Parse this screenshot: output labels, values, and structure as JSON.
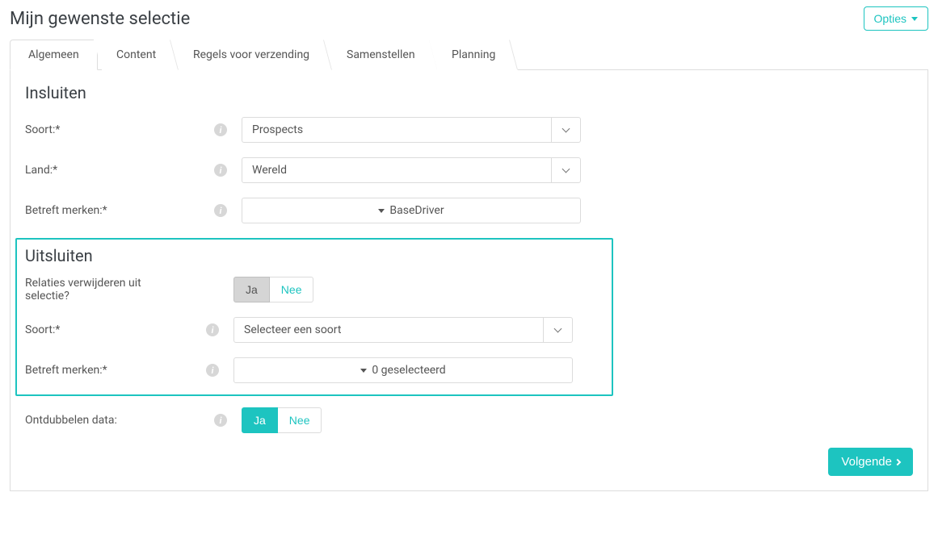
{
  "header": {
    "title": "Mijn gewenste selectie",
    "options_label": "Opties"
  },
  "tabs": [
    {
      "label": "Algemeen",
      "active": true
    },
    {
      "label": "Content",
      "active": false
    },
    {
      "label": "Regels voor verzending",
      "active": false
    },
    {
      "label": "Samenstellen",
      "active": false
    },
    {
      "label": "Planning",
      "active": false
    }
  ],
  "insluiten": {
    "title": "Insluiten",
    "soort_label": "Soort:*",
    "soort_value": "Prospects",
    "land_label": "Land:*",
    "land_value": "Wereld",
    "merken_label": "Betreft merken:*",
    "merken_value": "BaseDriver"
  },
  "uitsluiten": {
    "title": "Uitsluiten",
    "relaties_label": "Relaties verwijderen uit selectie?",
    "ja": "Ja",
    "nee": "Nee",
    "soort_label": "Soort:*",
    "soort_value": "Selecteer een soort",
    "merken_label": "Betreft merken:*",
    "merken_value": "0 geselecteerd"
  },
  "ontdubbelen": {
    "label": "Ontdubbelen data:",
    "ja": "Ja",
    "nee": "Nee"
  },
  "footer": {
    "next": "Volgende"
  }
}
